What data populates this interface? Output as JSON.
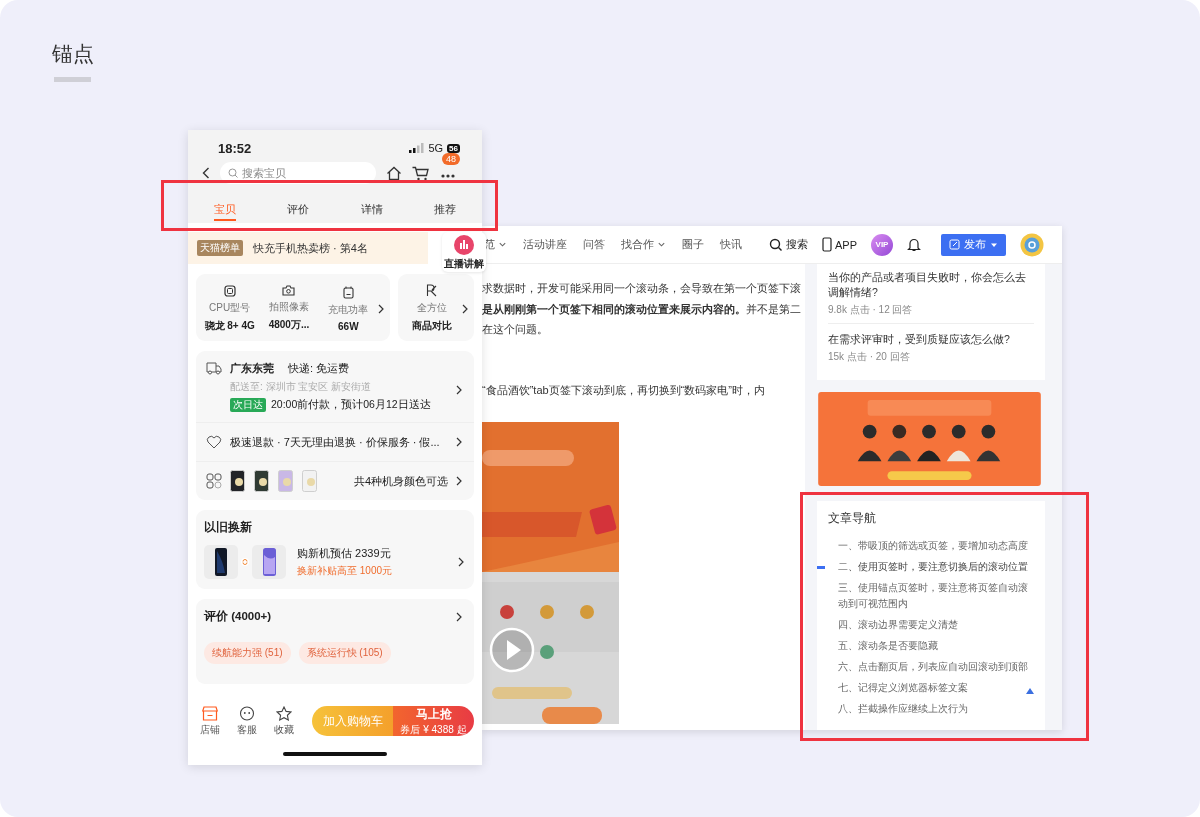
{
  "page_title": "锚点",
  "phone": {
    "status_bar": {
      "time": "18:52",
      "network": "5G",
      "battery": "56"
    },
    "search": {
      "placeholder": "搜索宝贝"
    },
    "cart_badge": "48",
    "tabs": [
      {
        "label": "宝贝",
        "selected": true
      },
      {
        "label": "评价",
        "selected": false
      },
      {
        "label": "详情",
        "selected": false
      },
      {
        "label": "推荐",
        "selected": false
      }
    ],
    "rank": {
      "badge": "天猫榜单",
      "text": "快充手机热卖榜 · 第4名"
    },
    "specs": [
      {
        "kind": "chip",
        "label": "CPU型号",
        "value": "骁龙 8+ 4G"
      },
      {
        "kind": "camera",
        "label": "拍照像素",
        "value": "4800万..."
      },
      {
        "kind": "battery",
        "label": "充电功率",
        "value": "66W"
      }
    ],
    "compare": {
      "label": "全方位",
      "value": "商品对比"
    },
    "shipping": {
      "origin": "广东东莞",
      "express": "快递: 免运费",
      "address": "配送至: 深圳市 宝安区 新安街道",
      "tag": "次日达",
      "eta": "20:00前付款，预计06月12日送达"
    },
    "services": "极速退款 · 7天无理由退换 · 价保服务 · 假...",
    "colors": "共4种机身颜色可选",
    "trade_in": {
      "title": "以旧换新",
      "estimate": "购新机预估 2339元",
      "subsidy": "换新补贴高至 1000元"
    },
    "reviews": {
      "title": "评价 (4000+)",
      "tags": [
        "续航能力强 (51)",
        "系统运行快 (105)"
      ]
    },
    "bottom_actions": [
      {
        "kind": "store",
        "label": "店铺"
      },
      {
        "kind": "service",
        "label": "客服"
      },
      {
        "kind": "favorite",
        "label": "收藏"
      }
    ],
    "cart_button": "加入购物车",
    "buy_button": {
      "label": "马上抢",
      "price": "券后 ¥ 4388 起"
    }
  },
  "web": {
    "live_button": "直播讲解",
    "nav": [
      {
        "label": "范",
        "dropdown": true
      },
      {
        "label": "活动讲座",
        "dropdown": false
      },
      {
        "label": "问答",
        "dropdown": false
      },
      {
        "label": "找合作",
        "dropdown": true
      },
      {
        "label": "圈子",
        "dropdown": false
      },
      {
        "label": "快讯",
        "dropdown": false
      }
    ],
    "search": "搜索",
    "app": "APP",
    "vip": "VIP",
    "publish": "发布",
    "article": [
      [
        "求数据时，开发可能采用同一个滚动条，会导致在第一个页签下滚",
        "**是从刚刚第一个页签下相同的滚动位置来展示内容的。**并不是第二",
        "在这个问题。"
      ],
      [
        "“食品酒饮”tab页签下滚动到底，再切换到“数码家电”时，内"
      ]
    ],
    "questions": [
      {
        "title": "当你的产品或者项目失败时，你会怎么去调解情绪?",
        "stats": "9.8k 点击 · 12 回答"
      },
      {
        "title": "在需求评审时，受到质疑应该怎么做?",
        "stats": "15k 点击 · 20 回答"
      }
    ],
    "toc": {
      "title": "文章导航",
      "items": [
        {
          "label": "一、带吸顶的筛选或页签，要增加动态高度",
          "selected": false
        },
        {
          "label": "二、使用页签时，要注意切换后的滚动位置",
          "selected": true
        },
        {
          "label": "三、使用锚点页签时，要注意将页签自动滚动到可视范围内",
          "selected": false
        },
        {
          "label": "四、滚动边界需要定义清楚",
          "selected": false
        },
        {
          "label": "五、滚动条是否要隐藏",
          "selected": false
        },
        {
          "label": "六、点击翻页后，列表应自动回滚动到顶部",
          "selected": false
        },
        {
          "label": "七、记得定义浏览器标签文案",
          "selected": false
        },
        {
          "label": "八、拦截操作应继续上次行为",
          "selected": false
        }
      ]
    }
  }
}
